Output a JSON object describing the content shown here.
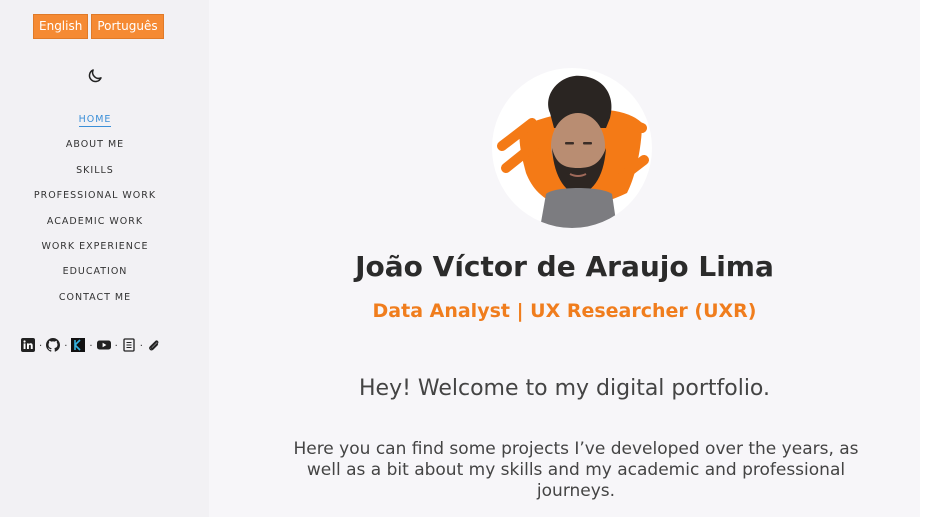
{
  "languages": {
    "english": "English",
    "portuguese": "Português"
  },
  "theme_toggle": {
    "icon": "moon-icon"
  },
  "nav": {
    "items": [
      {
        "label": "HOME",
        "active": true
      },
      {
        "label": "ABOUT ME"
      },
      {
        "label": "SKILLS"
      },
      {
        "label": "PROFESSIONAL WORK"
      },
      {
        "label": "ACADEMIC WORK"
      },
      {
        "label": "WORK EXPERIENCE"
      },
      {
        "label": "EDUCATION"
      },
      {
        "label": "CONTACT ME"
      }
    ]
  },
  "socials": {
    "icons": [
      "linkedin-icon",
      "github-icon",
      "kaggle-icon",
      "youtube-icon",
      "resume-document-icon",
      "link-icon"
    ],
    "separator": "."
  },
  "profile": {
    "name": "João Víctor de Araujo Lima",
    "role": "Data Analyst | UX Researcher (UXR)",
    "welcome": "Hey! Welcome to my digital portfolio.",
    "intro": "Here you can find some projects I’ve developed over the years, as well as a bit about my skills and my academic and professional journeys."
  },
  "colors": {
    "accent": "#f58a33",
    "role_text": "#f07d1d",
    "active_nav": "#3b8fd8",
    "sidebar_bg": "#f2f1f4",
    "main_bg": "#f7f6f9"
  }
}
